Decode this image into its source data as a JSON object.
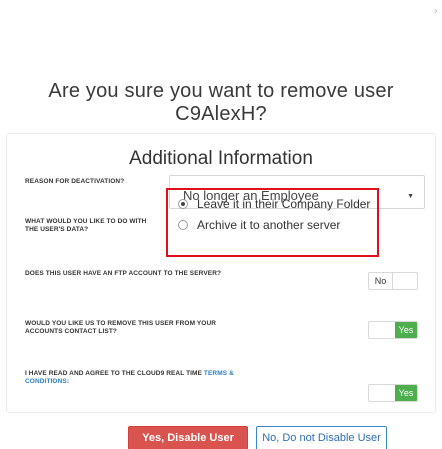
{
  "dialog": {
    "close_glyph": "›",
    "title": "Are you sure you want to remove user C9AlexH?"
  },
  "panel": {
    "title": "Additional Information",
    "reason": {
      "label": "Reason for deactivation?",
      "selected": "No longer an Employee"
    },
    "data_action": {
      "label": "What would you like to do with the user's data?",
      "options": [
        {
          "label": "Leave it in their Company Folder",
          "checked": true
        },
        {
          "label": "Archive it to another server",
          "checked": false
        }
      ]
    },
    "ftp": {
      "label": "Does this user have an FTP account to the server?",
      "toggle": "No"
    },
    "contact_list": {
      "label": "Would you like us to remove this user from your accounts contact list?",
      "toggle": "Yes"
    },
    "terms": {
      "label_prefix": "I have read and agree to the Cloud9 Real Time",
      "link": "Terms & Conditions",
      "label_suffix": ":",
      "toggle": "Yes"
    }
  },
  "buttons": {
    "confirm": "Yes, Disable User",
    "cancel": "No, Do not Disable User"
  },
  "colors": {
    "danger": "#d9534f",
    "primary": "#3a87c8",
    "toggle_on": "#4cae4c",
    "highlight": "#e0101a"
  }
}
